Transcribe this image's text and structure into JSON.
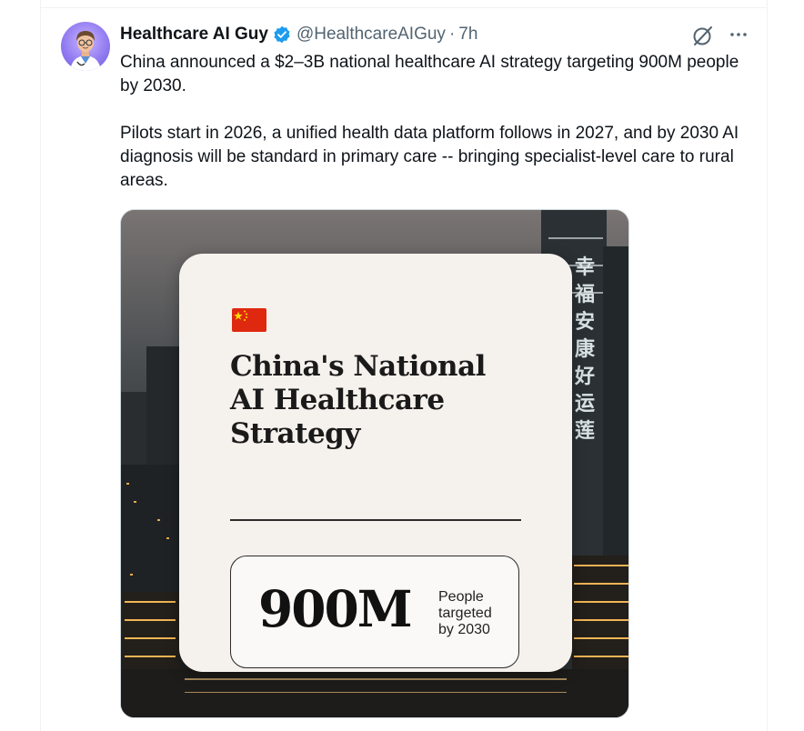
{
  "author": {
    "display_name": "Healthcare AI Guy",
    "handle": "@HealthcareAIGuy",
    "separator": "·",
    "time": "7h",
    "verified": true
  },
  "tweet": {
    "paragraph_1": "China announced a $2–3B national healthcare AI strategy targeting 900M people by 2030.",
    "paragraph_2": "Pilots start in 2026, a unified health data platform follows in 2027, and by 2030 AI diagnosis will be standard in primary care -- bringing specialist-level care to rural areas."
  },
  "media": {
    "flag": "china-flag-icon",
    "title_lines": [
      "China's National",
      "AI Healthcare",
      "Strategy"
    ],
    "stat_value": "900M",
    "stat_caption_lines": [
      "People",
      "targeted",
      "by 2030"
    ],
    "building_sign": [
      "幸",
      "福",
      "安",
      "康",
      "好",
      "运",
      "莲"
    ]
  },
  "colors": {
    "verified": "#1d9bf0",
    "text_primary": "#0f1419",
    "text_secondary": "#536471",
    "card_bg": "#f5f1ed"
  }
}
